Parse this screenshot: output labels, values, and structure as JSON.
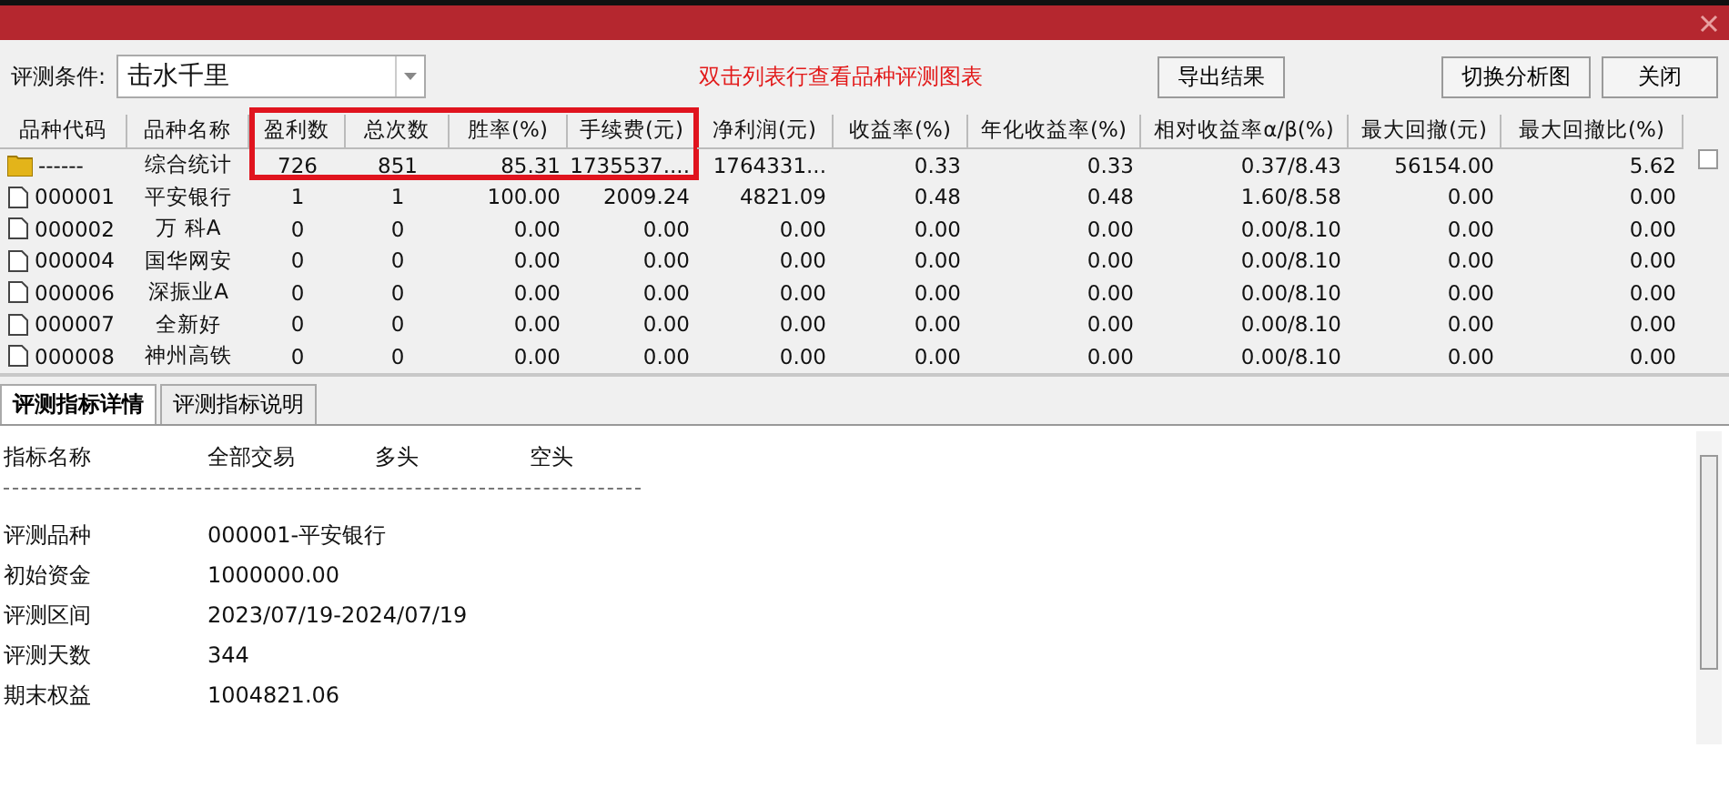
{
  "toolbar": {
    "condition_label": "评测条件:",
    "condition_value": "击水千里",
    "hint": "双击列表行查看品种评测图表",
    "buttons": [
      {
        "label": "导出结果",
        "kind": "left"
      },
      {
        "label": "切换分析图",
        "kind": "right"
      },
      {
        "label": "关闭",
        "kind": "right"
      }
    ]
  },
  "table": {
    "columns": [
      {
        "label": "品种代码",
        "highlighted": false
      },
      {
        "label": "品种名称",
        "highlighted": false
      },
      {
        "label": "盈利数",
        "highlighted": true
      },
      {
        "label": "总次数",
        "highlighted": true
      },
      {
        "label": "胜率(%)",
        "highlighted": true
      },
      {
        "label": "手续费(元)",
        "highlighted": true
      },
      {
        "label": "净利润(元)",
        "highlighted": false
      },
      {
        "label": "收益率(%)",
        "highlighted": false
      },
      {
        "label": "年化收益率(%)",
        "highlighted": false
      },
      {
        "label": "相对收益率α/β(%)",
        "highlighted": false
      },
      {
        "label": "最大回撤(元)",
        "highlighted": false
      },
      {
        "label": "最大回撤比(%)",
        "highlighted": false
      }
    ],
    "rows": [
      {
        "kind": "summary",
        "cells": [
          "------",
          "综合统计",
          "726",
          "851",
          "85.31",
          "1735537....",
          "1764331...",
          "0.33",
          "0.33",
          "0.37/8.43",
          "56154.00",
          "5.62"
        ]
      },
      {
        "kind": "item",
        "cells": [
          "000001",
          "平安银行",
          "1",
          "1",
          "100.00",
          "2009.24",
          "4821.09",
          "0.48",
          "0.48",
          "1.60/8.58",
          "0.00",
          "0.00"
        ]
      },
      {
        "kind": "item",
        "cells": [
          "000002",
          "万 科A",
          "0",
          "0",
          "0.00",
          "0.00",
          "0.00",
          "0.00",
          "0.00",
          "0.00/8.10",
          "0.00",
          "0.00"
        ]
      },
      {
        "kind": "item",
        "cells": [
          "000004",
          "国华网安",
          "0",
          "0",
          "0.00",
          "0.00",
          "0.00",
          "0.00",
          "0.00",
          "0.00/8.10",
          "0.00",
          "0.00"
        ]
      },
      {
        "kind": "item",
        "cells": [
          "000006",
          "深振业A",
          "0",
          "0",
          "0.00",
          "0.00",
          "0.00",
          "0.00",
          "0.00",
          "0.00/8.10",
          "0.00",
          "0.00"
        ]
      },
      {
        "kind": "item",
        "cells": [
          "000007",
          "全新好",
          "0",
          "0",
          "0.00",
          "0.00",
          "0.00",
          "0.00",
          "0.00",
          "0.00/8.10",
          "0.00",
          "0.00"
        ]
      },
      {
        "kind": "item",
        "cells": [
          "000008",
          "神州高铁",
          "0",
          "0",
          "0.00",
          "0.00",
          "0.00",
          "0.00",
          "0.00",
          "0.00/8.10",
          "0.00",
          "0.00"
        ]
      }
    ]
  },
  "grid_checkbox": {
    "checked": false
  },
  "tabs": [
    {
      "label": "评测指标详情",
      "selected": true
    },
    {
      "label": "评测指标说明",
      "selected": false
    }
  ],
  "details": {
    "headers": [
      "指标名称",
      "全部交易",
      "多头",
      "空头"
    ],
    "rows": [
      {
        "label": "评测品种",
        "value": "000001-平安银行"
      },
      {
        "label": "初始资金",
        "value": "1000000.00"
      },
      {
        "label": "评测区间",
        "value": "2023/07/19-2024/07/19"
      },
      {
        "label": "评测天数",
        "value": "344"
      },
      {
        "label": "期末权益",
        "value": "1004821.06"
      }
    ]
  }
}
